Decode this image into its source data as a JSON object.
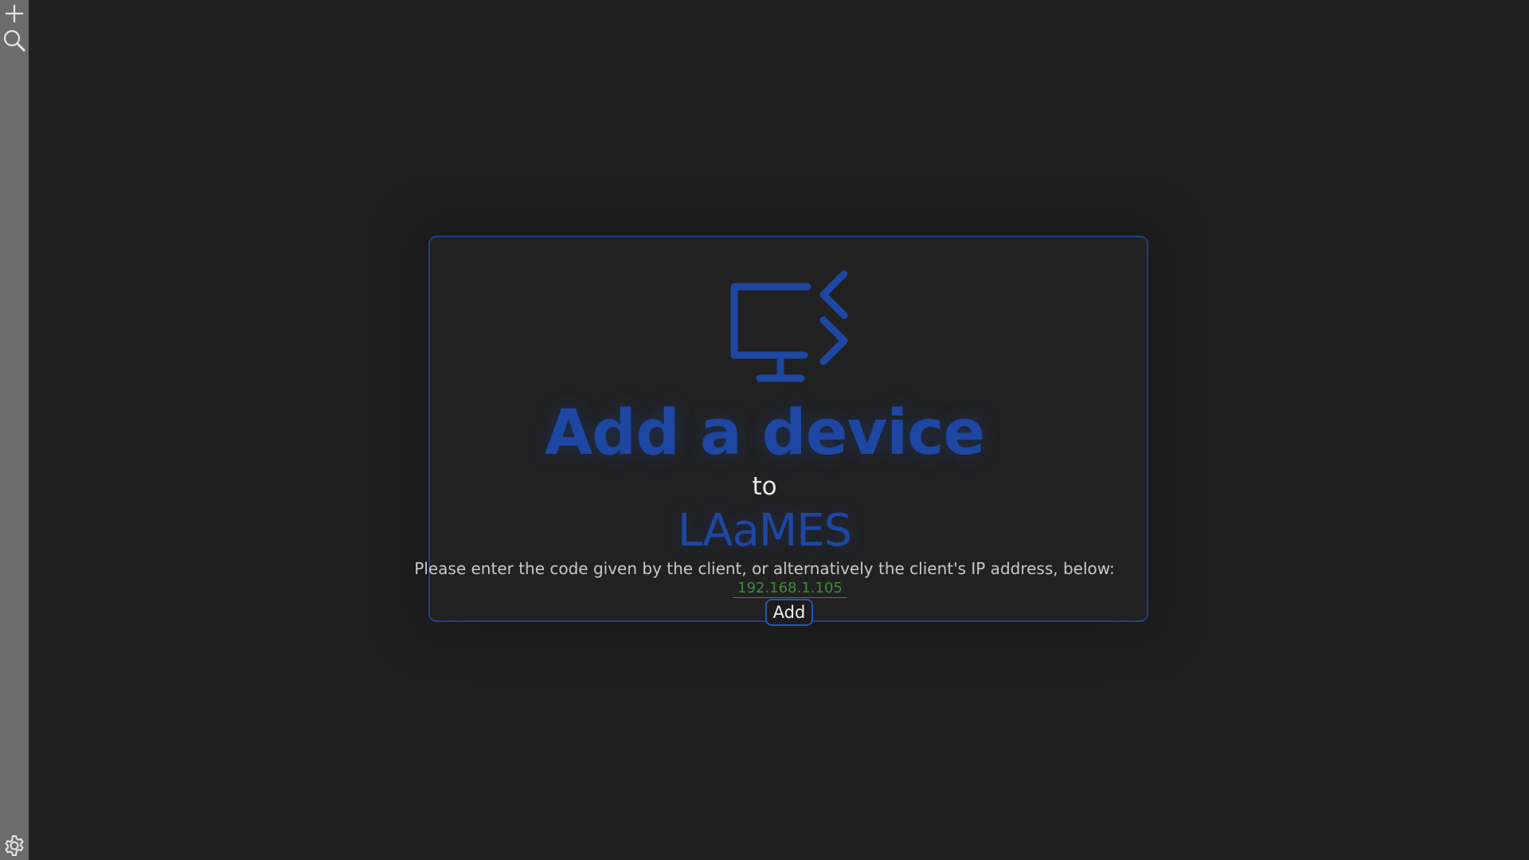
{
  "sidebar": {
    "icons": [
      "plus-icon",
      "search-icon",
      "gear-icon"
    ]
  },
  "dialog": {
    "title": "Add a device",
    "connector": "to",
    "app_name": "LAaMES",
    "instructions": "Please enter the code given by the client, or alternatively the client's IP address, below:",
    "code_field": {
      "value": "",
      "placeholder": "192.168.1.105"
    },
    "add_button_label": "Add",
    "icon": "monitor-code-icon"
  },
  "colors": {
    "background": "#202021",
    "sidebar": "#6c6c6c",
    "accent": "#1e47a3",
    "card_border": "#1f3f80",
    "field_text": "#3f8a3a",
    "button_border": "#2754b8"
  }
}
